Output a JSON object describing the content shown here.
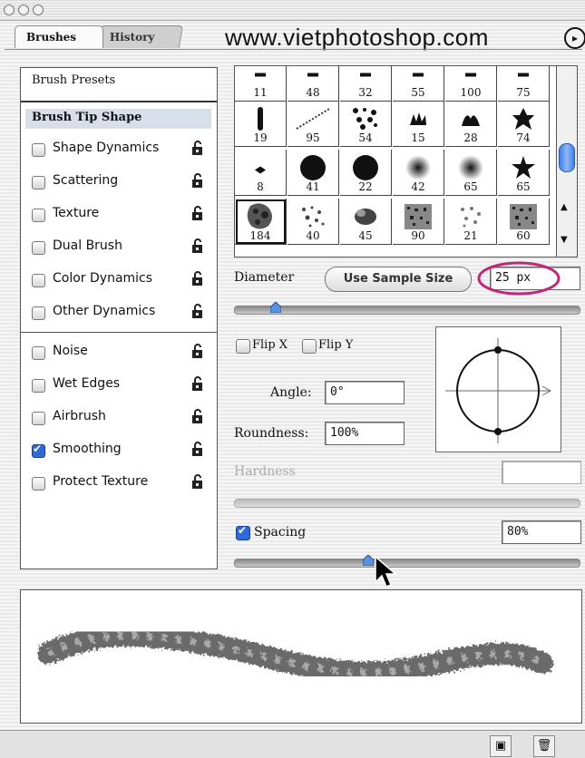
{
  "window": {
    "traffic_lights": [
      "close",
      "minimize",
      "zoom"
    ]
  },
  "tabs": [
    {
      "label": "Brushes",
      "active": true
    },
    {
      "label": "History",
      "active": false
    }
  ],
  "watermark": "www.vietphotoshop.com",
  "sidebar": {
    "presets_label": "Brush Presets",
    "tip_shape_label": "Brush Tip Shape",
    "items": [
      {
        "label": "Shape Dynamics",
        "checked": false,
        "lock": "lock-icon"
      },
      {
        "label": "Scattering",
        "checked": false,
        "lock": "lock-icon"
      },
      {
        "label": "Texture",
        "checked": false,
        "lock": "lock-icon"
      },
      {
        "label": "Dual Brush",
        "checked": false,
        "lock": "lock-icon"
      },
      {
        "label": "Color Dynamics",
        "checked": false,
        "lock": "lock-icon"
      },
      {
        "label": "Other Dynamics",
        "checked": false,
        "lock": "lock-icon"
      },
      {
        "label": "Noise",
        "checked": false,
        "lock": "lock-icon"
      },
      {
        "label": "Wet Edges",
        "checked": false,
        "lock": "lock-icon"
      },
      {
        "label": "Airbrush",
        "checked": false,
        "lock": "lock-icon"
      },
      {
        "label": "Smoothing",
        "checked": true,
        "lock": "lock-icon"
      },
      {
        "label": "Protect Texture",
        "checked": false,
        "lock": "lock-icon"
      }
    ]
  },
  "brushes": [
    {
      "size": "11",
      "kind": "partial"
    },
    {
      "size": "48",
      "kind": "partial"
    },
    {
      "size": "32",
      "kind": "partial"
    },
    {
      "size": "55",
      "kind": "partial"
    },
    {
      "size": "100",
      "kind": "partial"
    },
    {
      "size": "75",
      "kind": "partial"
    },
    {
      "size": "19",
      "kind": "bar"
    },
    {
      "size": "95",
      "kind": "dotted-line"
    },
    {
      "size": "54",
      "kind": "dots"
    },
    {
      "size": "15",
      "kind": "grass"
    },
    {
      "size": "28",
      "kind": "leaves"
    },
    {
      "size": "74",
      "kind": "leaf"
    },
    {
      "size": "8",
      "kind": "small"
    },
    {
      "size": "41",
      "kind": "hard-round"
    },
    {
      "size": "22",
      "kind": "hard-round"
    },
    {
      "size": "42",
      "kind": "soft-round"
    },
    {
      "size": "65",
      "kind": "soft-round"
    },
    {
      "size": "65",
      "kind": "star"
    },
    {
      "size": "184",
      "kind": "texture",
      "selected": true
    },
    {
      "size": "40",
      "kind": "spatter"
    },
    {
      "size": "45",
      "kind": "smudge"
    },
    {
      "size": "90",
      "kind": "noise"
    },
    {
      "size": "21",
      "kind": "spatter-light"
    },
    {
      "size": "60",
      "kind": "noise"
    }
  ],
  "diameter": {
    "label": "Diameter",
    "button": "Use Sample Size",
    "value": "25 px",
    "slider_fraction": 0.12
  },
  "flip": {
    "x_label": "Flip X",
    "y_label": "Flip Y",
    "x_checked": false,
    "y_checked": false
  },
  "angle": {
    "label": "Angle:",
    "value": "0°"
  },
  "roundness": {
    "label": "Roundness:",
    "value": "100%"
  },
  "hardness": {
    "label": "Hardness",
    "value": "",
    "disabled": true
  },
  "spacing": {
    "label": "Spacing",
    "checked": true,
    "value": "80%",
    "slider_fraction": 0.39
  },
  "bottom_buttons": [
    "new-brush-icon",
    "trash-icon"
  ],
  "colors": {
    "highlight_circle": "#c0267a",
    "checkbox_blue": "#2f6ad7",
    "tip_selected": "#d9dfe9"
  }
}
